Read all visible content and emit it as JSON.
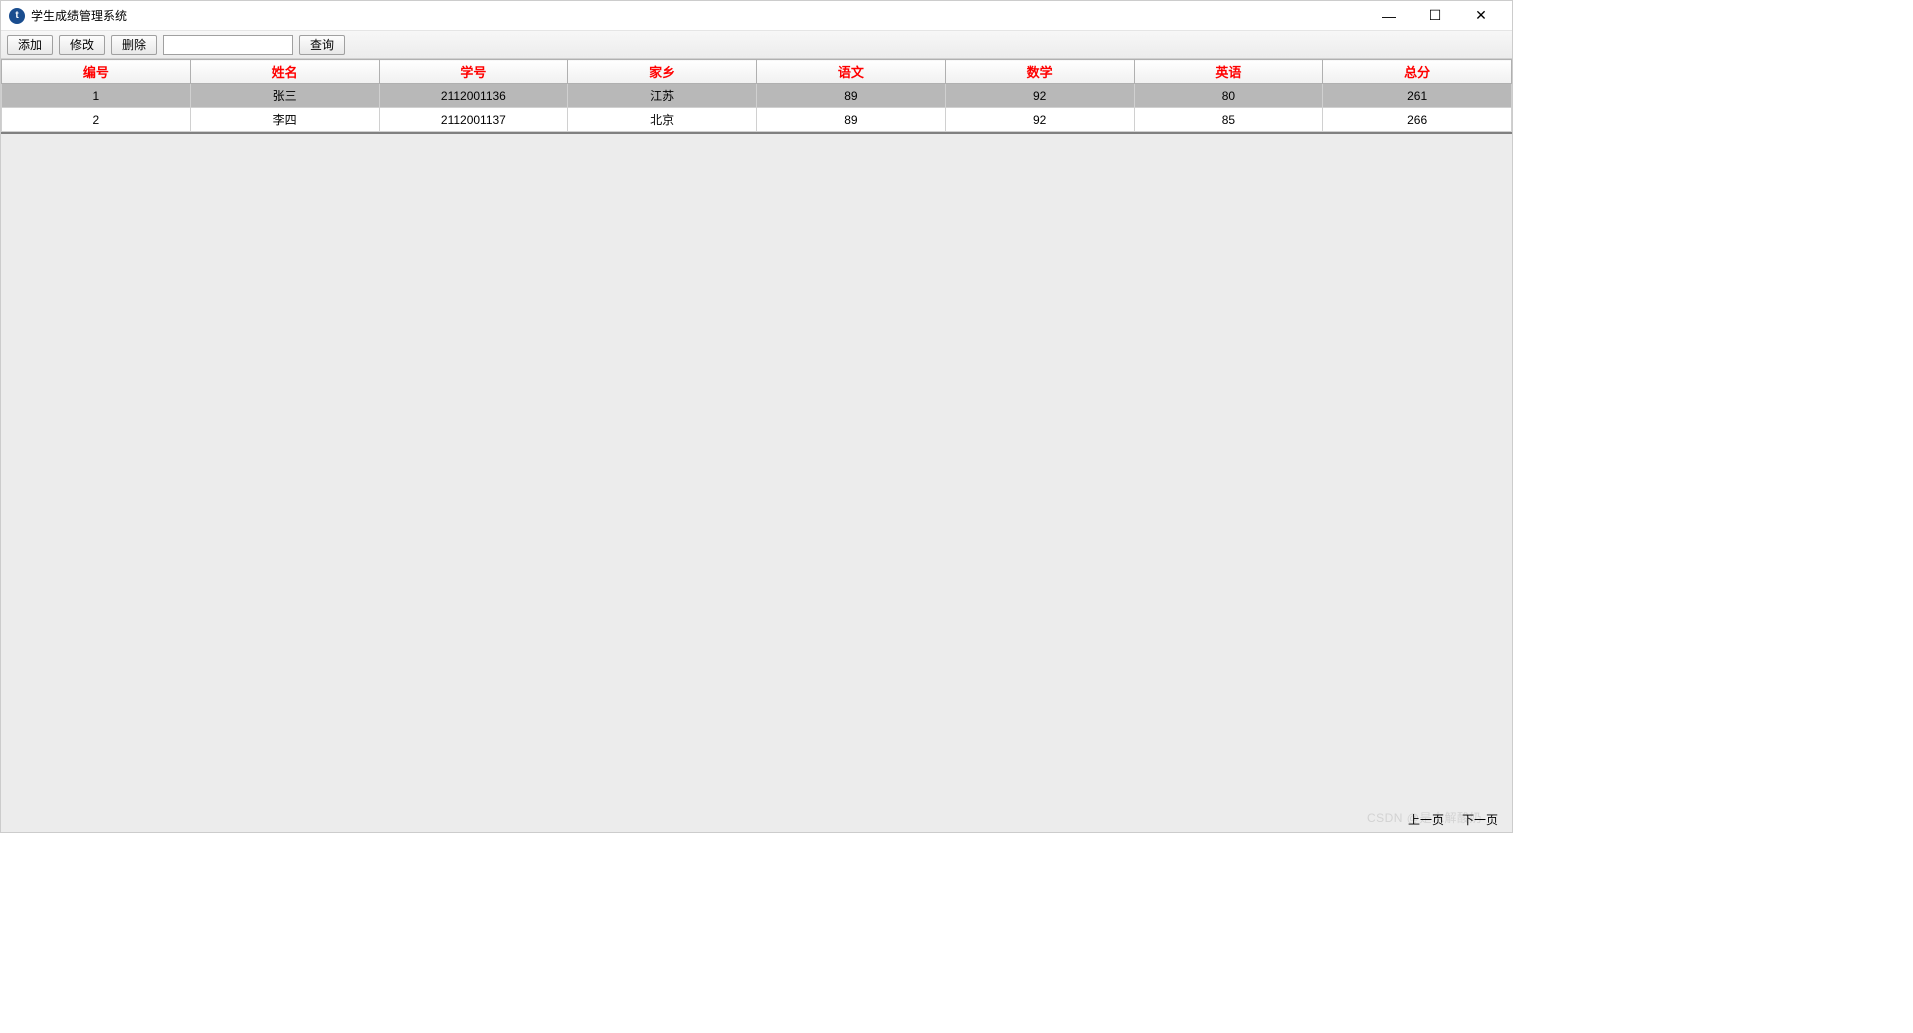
{
  "window": {
    "title": "学生成绩管理系统",
    "icon_letter": "t"
  },
  "toolbar": {
    "add_label": "添加",
    "edit_label": "修改",
    "delete_label": "删除",
    "search_value": "",
    "query_label": "查询"
  },
  "table": {
    "headers": [
      "编号",
      "姓名",
      "学号",
      "家乡",
      "语文",
      "数学",
      "英语",
      "总分"
    ],
    "rows": [
      {
        "selected": true,
        "cells": [
          "1",
          "张三",
          "2112001136",
          "江苏",
          "89",
          "92",
          "80",
          "261"
        ]
      },
      {
        "selected": false,
        "cells": [
          "2",
          "李四",
          "2112001137",
          "北京",
          "89",
          "92",
          "85",
          "266"
        ]
      }
    ]
  },
  "footer": {
    "prev_label": "上一页",
    "next_label": "下一页"
  },
  "watermark": "CSDN @是水解酸奶"
}
